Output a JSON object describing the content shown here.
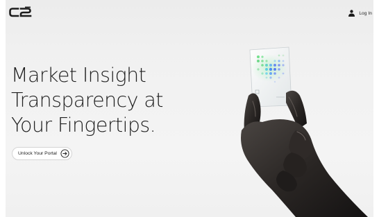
{
  "header": {
    "logo_text": "C2",
    "logo_icon": "c2-logo-icon",
    "login_icon": "person-icon",
    "login_label": "Log In"
  },
  "hero": {
    "headline_lines": [
      "Market Insight",
      "Transparency at",
      "Your Fingertips."
    ],
    "cta_label": "Unlock Your Portal",
    "cta_icon": "arrow-right-circle-icon",
    "image": "hand-holding-glass-card-image"
  },
  "colors": {
    "background": "#f1f1f1",
    "text": "#1f1f1f",
    "button_bg": "#ffffff",
    "card_accent_green": "#6fd88a",
    "card_accent_blue": "#6c8cf0"
  }
}
